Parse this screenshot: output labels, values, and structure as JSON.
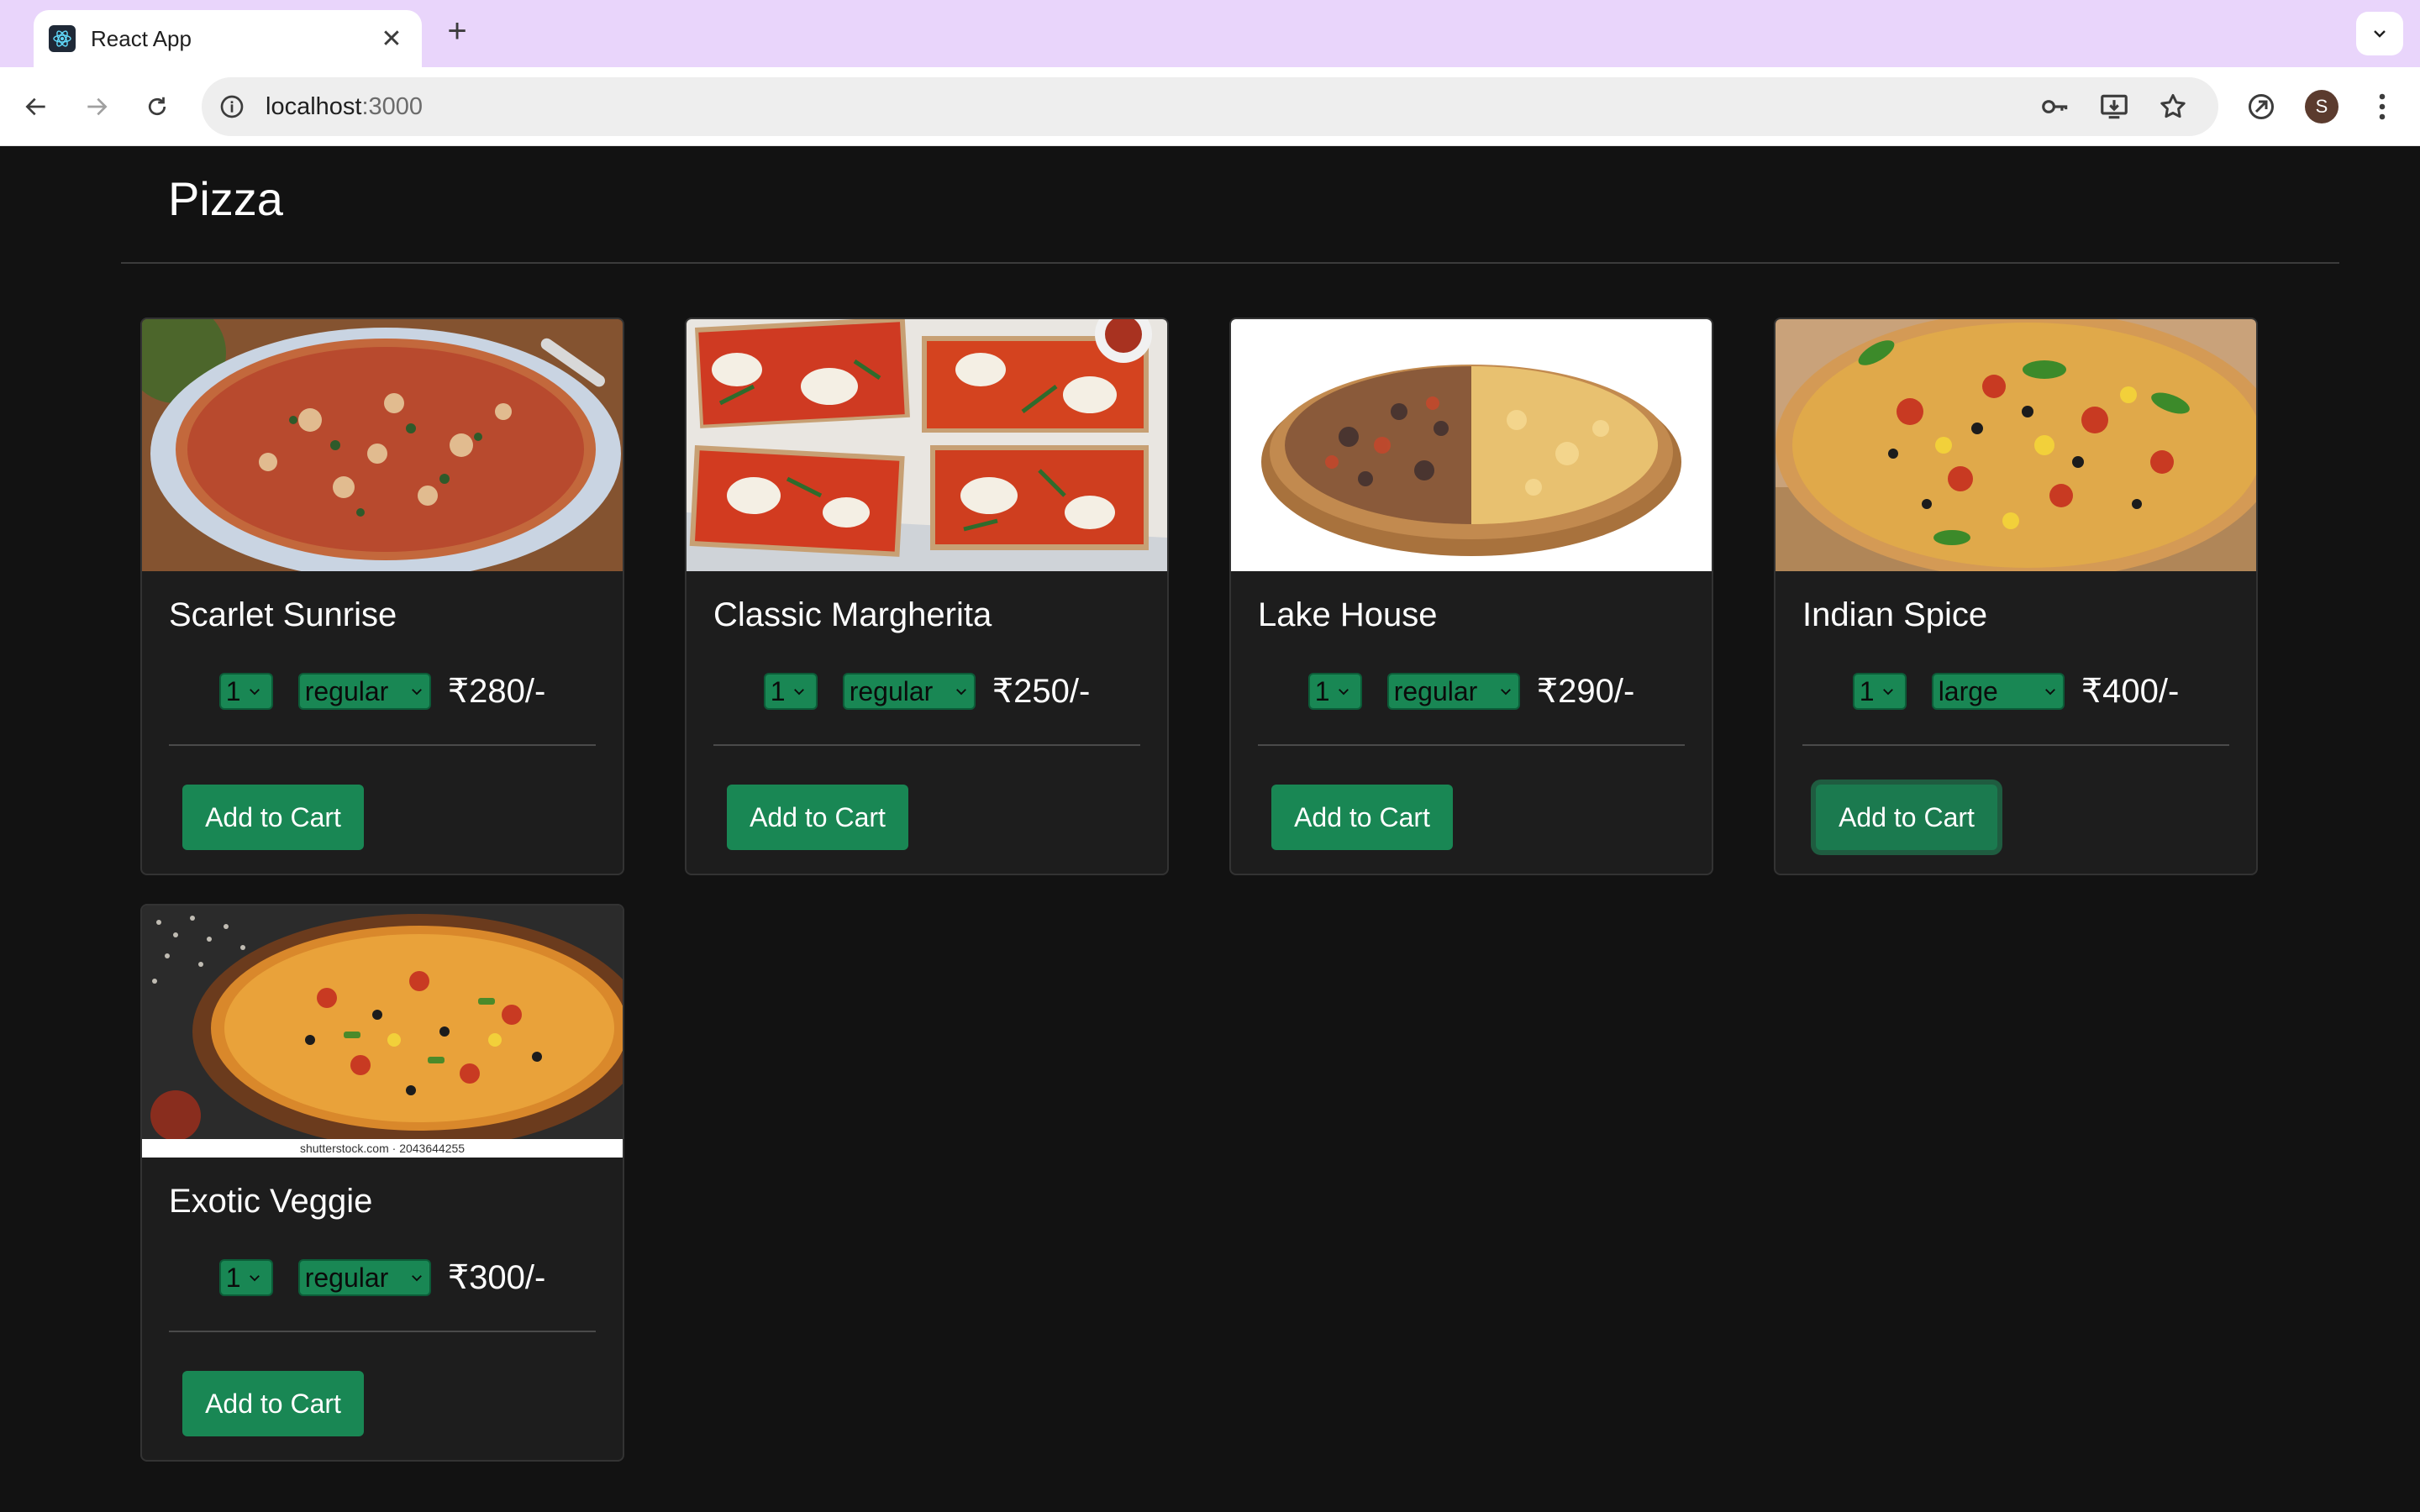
{
  "browser": {
    "tab_title": "React App",
    "url_host": "localhost",
    "url_port": ":3000",
    "avatar_initial": "S"
  },
  "page": {
    "title": "Pizza"
  },
  "products": [
    {
      "name": "Scarlet Sunrise",
      "qty": "1",
      "size": "regular",
      "price": "₹280/-",
      "button": "Add to Cart"
    },
    {
      "name": "Classic Margherita",
      "qty": "1",
      "size": "regular",
      "price": "₹250/-",
      "button": "Add to Cart"
    },
    {
      "name": "Lake House",
      "qty": "1",
      "size": "regular",
      "price": "₹290/-",
      "button": "Add to Cart"
    },
    {
      "name": "Indian Spice",
      "qty": "1",
      "size": "large",
      "price": "₹400/-",
      "button": "Add to Cart"
    },
    {
      "name": "Exotic Veggie",
      "qty": "1",
      "size": "regular",
      "price": "₹300/-",
      "button": "Add to Cart",
      "image_caption": "shutterstock.com · 2043644255"
    }
  ]
}
